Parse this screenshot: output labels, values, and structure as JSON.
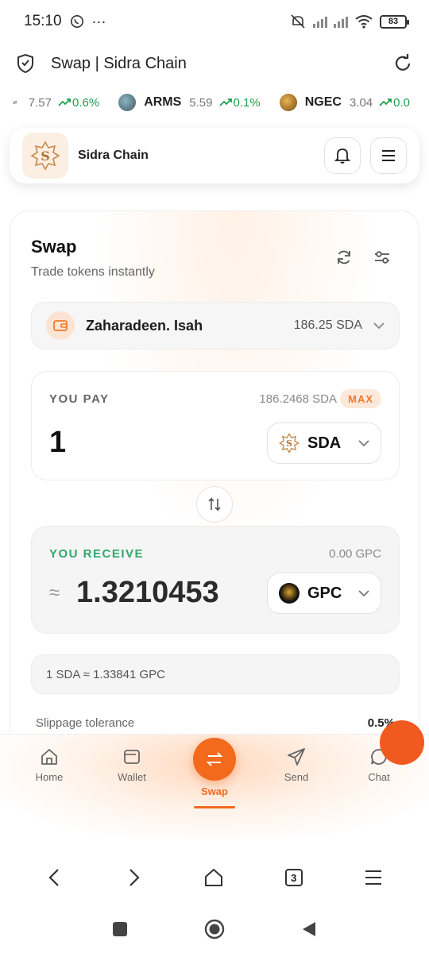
{
  "status_bar": {
    "time": "15:10",
    "more": "···",
    "battery": "83"
  },
  "browser": {
    "title": "Swap | Sidra Chain"
  },
  "ticker": [
    {
      "price": "7.57",
      "change": "0.6%"
    },
    {
      "name": "ARMS",
      "price": "5.59",
      "change": "0.1%"
    },
    {
      "name": "NGEC",
      "price": "3.04",
      "change": "0.0"
    }
  ],
  "header": {
    "brand": "Sidra Chain"
  },
  "swap": {
    "title": "Swap",
    "subtitle": "Trade tokens instantly",
    "account": {
      "name": "Zaharadeen. Isah",
      "balance": "186.25 SDA"
    },
    "pay": {
      "label": "YOU PAY",
      "balance": "186.2468 SDA",
      "max": "MAX",
      "amount": "1",
      "token": "SDA"
    },
    "receive": {
      "label": "YOU RECEIVE",
      "balance": "0.00 GPC",
      "approx": "≈",
      "amount": "1.3210453",
      "token": "GPC"
    },
    "rate": "1 SDA ≈ 1.33841 GPC",
    "slippage_label": "Slippage tolerance",
    "slippage_value": "0.5%"
  },
  "nav": {
    "home": "Home",
    "wallet": "Wallet",
    "swap": "Swap",
    "send": "Send",
    "chat": "Chat"
  },
  "browser_nav": {
    "tab_count": "3"
  },
  "colors": {
    "accent": "#f36a1d",
    "positive": "#1fa14c",
    "receive_label": "#2fa86b"
  }
}
